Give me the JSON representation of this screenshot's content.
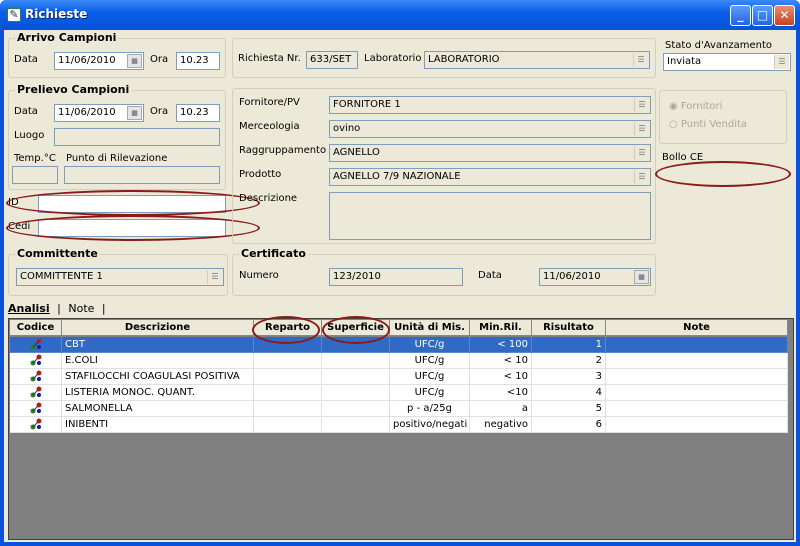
{
  "window": {
    "title": "Richieste"
  },
  "arrivo": {
    "title": "Arrivo Campioni",
    "data_label": "Data",
    "data": "11/06/2010",
    "ora_label": "Ora",
    "ora": "10.23"
  },
  "prelievo": {
    "title": "Prelievo Campioni",
    "data_label": "Data",
    "data": "11/06/2010",
    "ora_label": "Ora",
    "ora": "10.23",
    "luogo_label": "Luogo",
    "temp_label": "Temp.°C",
    "punto_label": "Punto di Rilevazione"
  },
  "id_label": "ID",
  "cedi_label": "Cedi",
  "richiesta": {
    "nr_label": "Richiesta Nr.",
    "nr": "633/SET",
    "lab_label": "Laboratorio",
    "lab": "LABORATORIO"
  },
  "stato": {
    "label": "Stato d'Avanzamento",
    "value": "Inviata"
  },
  "prodotto": {
    "fornitore_label": "Fornitore/PV",
    "fornitore": "FORNITORE 1",
    "merceologia_label": "Merceologia",
    "merceologia": "ovino",
    "raggr_label": "Raggruppamento",
    "raggr": "AGNELLO",
    "prodotto_label": "Prodotto",
    "prodotto": "AGNELLO 7/9 NAZIONALE",
    "descr_label": "Descrizione"
  },
  "radio": {
    "fornitori": "Fornitori",
    "punti": "Punti Vendita"
  },
  "bollo_label": "Bollo CE",
  "committente": {
    "title": "Committente",
    "value": "COMMITTENTE 1"
  },
  "certificato": {
    "title": "Certificato",
    "numero_label": "Numero",
    "numero": "123/2010",
    "data_label": "Data",
    "data": "11/06/2010"
  },
  "tabs": [
    "Analisi",
    "Note"
  ],
  "table": {
    "columns": [
      "Codice",
      "Descrizione",
      "Reparto",
      "Superficie",
      "Unità di Mis.",
      "Min.Ril.",
      "Risultato",
      "Note"
    ],
    "rows": [
      {
        "descr": "CBT",
        "unita": "UFC/g",
        "min": "< 100",
        "ris": "1",
        "sel": true
      },
      {
        "descr": "E.COLI",
        "unita": "UFC/g",
        "min": "< 10",
        "ris": "2"
      },
      {
        "descr": "STAFILOCCHI COAGULASI POSITIVA",
        "unita": "UFC/g",
        "min": "< 10",
        "ris": "3"
      },
      {
        "descr": "LISTERIA MONOC. QUANT.",
        "unita": "UFC/g",
        "min": "<10",
        "ris": "4"
      },
      {
        "descr": "SALMONELLA",
        "unita": "p - a/25g",
        "min": "a",
        "ris": "5"
      },
      {
        "descr": "INIBENTI",
        "unita": "positivo/negati",
        "min": "negativo",
        "ris": "6"
      }
    ]
  }
}
